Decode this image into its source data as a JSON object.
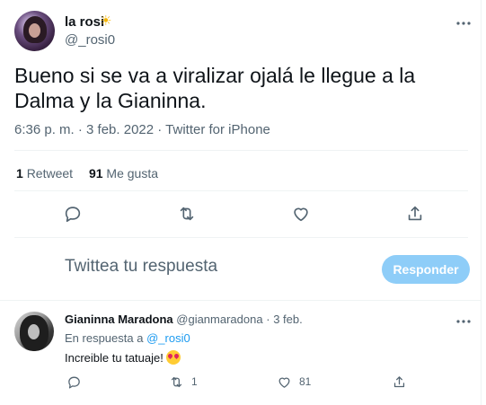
{
  "tweet": {
    "author_name": "la rosi",
    "author_emoji": "☀",
    "author_handle": "@_rosi0",
    "text": "Bueno si se va a viralizar ojalá le llegue a la Dalma y la Gianinna.",
    "meta": "6:36 p. m. · 3 feb. 2022 · Twitter for iPhone",
    "retweets_count": "1",
    "retweets_label": "Retweet",
    "likes_count": "91",
    "likes_label": "Me gusta"
  },
  "actions": {
    "icons": [
      "reply-icon",
      "retweet-icon",
      "like-icon",
      "share-icon"
    ]
  },
  "composer": {
    "placeholder": "Twittea tu respuesta",
    "button_label": "Responder",
    "button_color": "#8ecdf8"
  },
  "reply": {
    "author_name": "Gianinna Maradona",
    "author_handle": "@gianmaradona",
    "dot": "·",
    "date": "3 feb.",
    "in_reply_prefix": "En respuesta a",
    "in_reply_handle": "@_rosi0",
    "text": "Increible tu tatuaje!",
    "emoji": "heart-eyes-emoji",
    "retweets": "1",
    "likes": "81"
  },
  "colors": {
    "accent": "#1d9bf0",
    "secondary_text": "#536471",
    "primary_text": "#0f1419"
  }
}
